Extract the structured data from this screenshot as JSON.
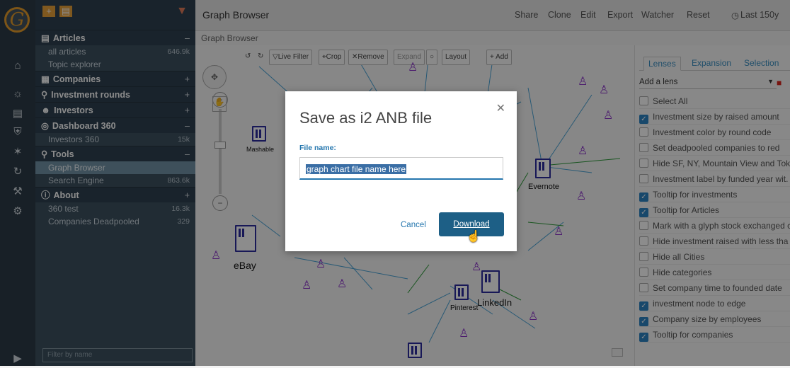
{
  "app": {
    "title": "Graph Browser",
    "breadcrumb": "Graph Browser"
  },
  "topbar": {
    "actions": [
      "Share",
      "Clone",
      "Edit",
      "Export",
      "Watcher",
      "Reset"
    ],
    "time_range": "Last 150y"
  },
  "sidebar": {
    "sections": [
      {
        "label": "Articles",
        "state": "–",
        "items": [
          {
            "label": "all articles",
            "count": "646.9k"
          },
          {
            "label": "Topic explorer",
            "count": ""
          }
        ]
      },
      {
        "label": "Companies",
        "state": "+",
        "items": []
      },
      {
        "label": "Investment rounds",
        "state": "+",
        "items": []
      },
      {
        "label": "Investors",
        "state": "+",
        "items": []
      },
      {
        "label": "Dashboard 360",
        "state": "–",
        "items": [
          {
            "label": "Investors 360",
            "count": "15k"
          }
        ]
      },
      {
        "label": "Tools",
        "state": "–",
        "items": [
          {
            "label": "Graph Browser",
            "count": ""
          },
          {
            "label": "Search Engine",
            "count": "863.6k"
          }
        ]
      },
      {
        "label": "About",
        "state": "+",
        "items": [
          {
            "label": "360 test",
            "count": "16.3k"
          },
          {
            "label": "Companies Deadpooled",
            "count": "329"
          }
        ]
      }
    ],
    "filter_placeholder": "Filter by name"
  },
  "toolbar": {
    "live_filter": "Live Filter",
    "crop": "Crop",
    "remove": "Remove",
    "expand": "Expand",
    "layout": "Layout",
    "add": "+ Add"
  },
  "graph": {
    "nodes": [
      "Mashable",
      "eBay",
      "Evernote",
      "Pinterest",
      "LinkedIn"
    ]
  },
  "right_panel": {
    "tabs": [
      "Lenses",
      "Expansion",
      "Selection"
    ],
    "add_lens": "Add a lens",
    "lenses": [
      {
        "label": "Select All",
        "checked": false
      },
      {
        "label": "Investment size by raised amount",
        "checked": true
      },
      {
        "label": "Investment color by round code",
        "checked": false
      },
      {
        "label": "Set deadpooled companies to red",
        "checked": false
      },
      {
        "label": "Hide SF, NY, Mountain View and Tok",
        "checked": false
      },
      {
        "label": "Investment label by funded year wit.",
        "checked": false
      },
      {
        "label": "Tooltip for investments",
        "checked": true
      },
      {
        "label": "Tooltip for Articles",
        "checked": true
      },
      {
        "label": "Mark with a glyph stock exchanged c",
        "checked": false
      },
      {
        "label": "Hide investment raised with less tha",
        "checked": false
      },
      {
        "label": "Hide all Cities",
        "checked": false
      },
      {
        "label": "Hide categories",
        "checked": false
      },
      {
        "label": "Set company time to founded date",
        "checked": false
      },
      {
        "label": "investment node to edge",
        "checked": true
      },
      {
        "label": "Company size by employees",
        "checked": true
      },
      {
        "label": "Tooltip for companies",
        "checked": true
      }
    ]
  },
  "dialog": {
    "title": "Save as i2 ANB file",
    "field_label": "File name:",
    "field_value": "graph chart file name here",
    "cancel_label": "Cancel",
    "download_label": "Download"
  }
}
